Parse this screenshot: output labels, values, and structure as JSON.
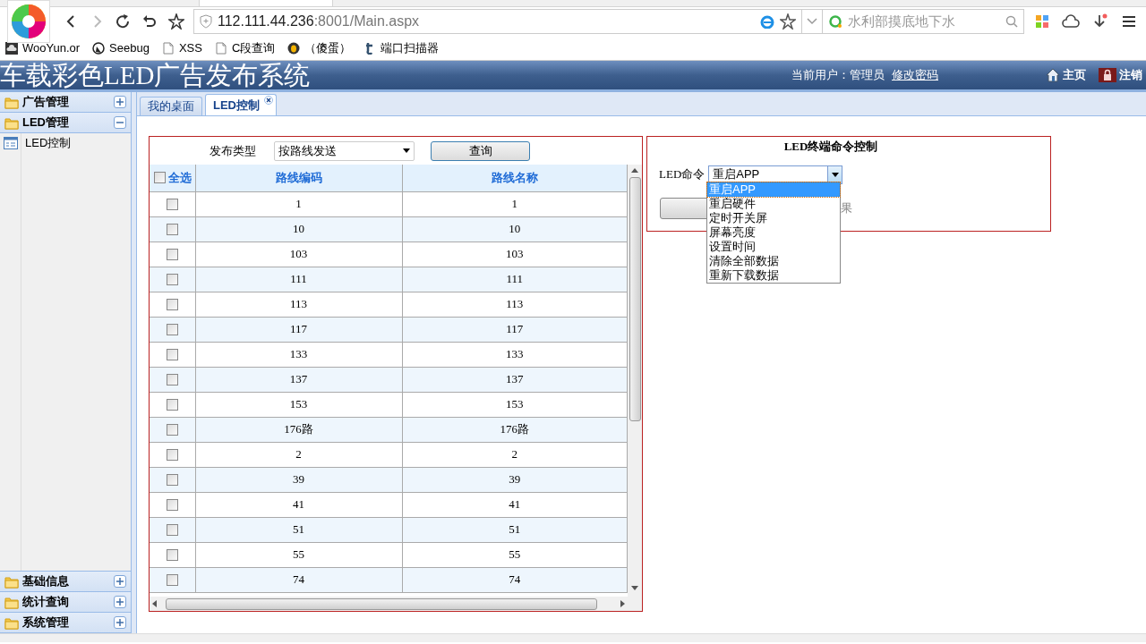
{
  "browser": {
    "url_host": "112.111.44.236",
    "url_rest": ":8001/Main.aspx",
    "search_placeholder": "水利部摸底地下水",
    "bookmarks": [
      {
        "label": "WooYun.or",
        "kind": "cloud"
      },
      {
        "label": "Seebug",
        "kind": "bug"
      },
      {
        "label": "XSS",
        "kind": "page"
      },
      {
        "label": "C段查询",
        "kind": "page"
      },
      {
        "label": "（傻蛋）",
        "kind": "egg"
      },
      {
        "label": "端口扫描器",
        "kind": "t"
      }
    ]
  },
  "header": {
    "title": "车载彩色LED广告发布系统",
    "user_label": "当前用户：管理员",
    "change_password": "修改密码",
    "home": "主页",
    "logout": "注销"
  },
  "sidebar": {
    "sections": [
      {
        "label": "广告管理",
        "expanded": false
      },
      {
        "label": "LED管理",
        "expanded": true,
        "children": [
          {
            "label": "LED控制"
          }
        ]
      },
      {
        "label": "基础信息",
        "expanded": false
      },
      {
        "label": "统计查询",
        "expanded": false
      },
      {
        "label": "系统管理",
        "expanded": false
      }
    ]
  },
  "tabs": [
    {
      "label": "我的桌面",
      "selected": false,
      "closable": false
    },
    {
      "label": "LED控制",
      "selected": true,
      "closable": true
    }
  ],
  "route_panel": {
    "filter_label": "发布类型",
    "filter_value": "按路线发送",
    "query_button": "查询",
    "select_all": "全选",
    "select_all_checked": false,
    "columns": [
      "路线编码",
      "路线名称"
    ],
    "rows": [
      {
        "code": "1",
        "name": "1",
        "checked": false
      },
      {
        "code": "10",
        "name": "10",
        "checked": false
      },
      {
        "code": "103",
        "name": "103",
        "checked": false
      },
      {
        "code": "111",
        "name": "111",
        "checked": false
      },
      {
        "code": "113",
        "name": "113",
        "checked": false
      },
      {
        "code": "117",
        "name": "117",
        "checked": false
      },
      {
        "code": "133",
        "name": "133",
        "checked": false
      },
      {
        "code": "137",
        "name": "137",
        "checked": false
      },
      {
        "code": "153",
        "name": "153",
        "checked": false
      },
      {
        "code": "176路",
        "name": "176路",
        "checked": false
      },
      {
        "code": "2",
        "name": "2",
        "checked": false
      },
      {
        "code": "39",
        "name": "39",
        "checked": false
      },
      {
        "code": "41",
        "name": "41",
        "checked": false
      },
      {
        "code": "51",
        "name": "51",
        "checked": false
      },
      {
        "code": "55",
        "name": "55",
        "checked": false
      },
      {
        "code": "74",
        "name": "74",
        "checked": false
      }
    ]
  },
  "command_panel": {
    "title": "LED终端命令控制",
    "command_label": "LED命令",
    "command_value": "重启APP",
    "result_fragment": "果",
    "options": [
      {
        "label": "重启APP",
        "selected": true
      },
      {
        "label": "重启硬件",
        "selected": false
      },
      {
        "label": "定时开关屏",
        "selected": false
      },
      {
        "label": "屏幕亮度",
        "selected": false
      },
      {
        "label": "设置时间",
        "selected": false
      },
      {
        "label": "清除全部数据",
        "selected": false
      },
      {
        "label": "重新下载数据",
        "selected": false
      }
    ]
  }
}
